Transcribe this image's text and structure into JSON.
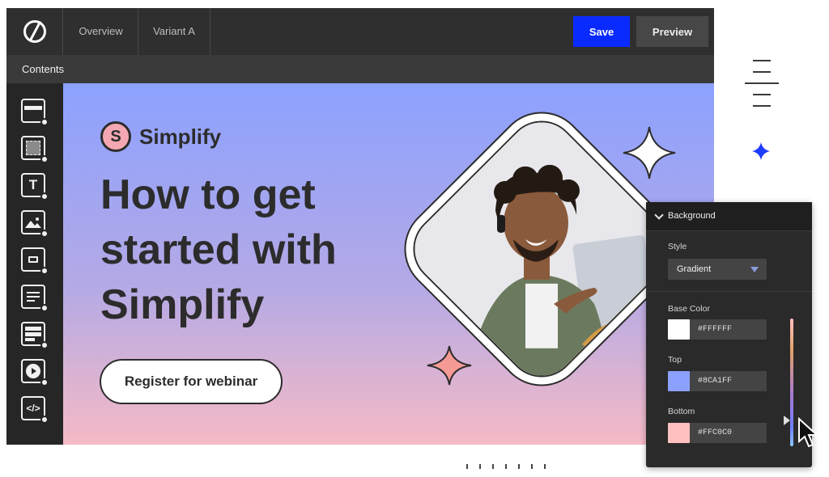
{
  "topbar": {
    "tabs": [
      "Overview",
      "Variant A"
    ],
    "save_label": "Save",
    "preview_label": "Preview"
  },
  "contents_label": "Contents",
  "toolbar": {
    "tools": [
      {
        "name": "section-tool",
        "icon": "section-icon",
        "glyph": ""
      },
      {
        "name": "box-tool",
        "icon": "box-icon",
        "glyph": ""
      },
      {
        "name": "text-tool",
        "icon": "text-icon",
        "glyph": "T"
      },
      {
        "name": "image-tool",
        "icon": "image-icon",
        "glyph": ""
      },
      {
        "name": "button-tool",
        "icon": "button-icon",
        "glyph": ""
      },
      {
        "name": "form-tool",
        "icon": "form-icon",
        "glyph": ""
      },
      {
        "name": "list-tool",
        "icon": "list-icon",
        "glyph": ""
      },
      {
        "name": "video-tool",
        "icon": "video-icon",
        "glyph": "▶"
      },
      {
        "name": "code-tool",
        "icon": "code-icon",
        "glyph": "</>"
      }
    ]
  },
  "canvas": {
    "brand_initial": "S",
    "brand_name": "Simplify",
    "headline_lines": [
      "How to get",
      "started with",
      "Simplify"
    ],
    "cta_label": "Register for webinar"
  },
  "panel": {
    "title": "Background",
    "style_label": "Style",
    "style_value": "Gradient",
    "base_color_label": "Base Color",
    "base_color_hex": "#FFFFFF",
    "top_label": "Top",
    "top_hex": "#8CA1FF",
    "bottom_label": "Bottom",
    "bottom_hex": "#FFC0C0"
  },
  "colors": {
    "accent": "#0a2bff",
    "gradient_top": "#8ca1ff",
    "gradient_bottom": "#ffc0c0",
    "base": "#ffffff",
    "sparkle_pink": "#f59a95"
  }
}
